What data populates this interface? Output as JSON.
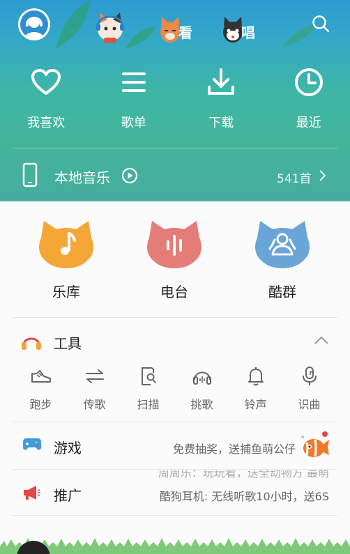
{
  "top_tabs": [
    {
      "name": "listen",
      "label": ""
    },
    {
      "name": "watch",
      "label": "看"
    },
    {
      "name": "sing",
      "label": "唱"
    }
  ],
  "quick_actions": [
    {
      "label": "我喜欢",
      "icon": "heart-icon"
    },
    {
      "label": "歌单",
      "icon": "list-icon"
    },
    {
      "label": "下载",
      "icon": "download-icon"
    },
    {
      "label": "最近",
      "icon": "clock-icon"
    }
  ],
  "local_music": {
    "label": "本地音乐",
    "count": "541首"
  },
  "main_entries": [
    {
      "label": "乐库",
      "icon": "music-note-icon",
      "color": "#f4a637"
    },
    {
      "label": "电台",
      "icon": "radio-wave-icon",
      "color": "#e47c78"
    },
    {
      "label": "酷群",
      "icon": "group-icon",
      "color": "#6aa5d8"
    }
  ],
  "tools": {
    "title": "工具",
    "items": [
      {
        "label": "跑步",
        "icon": "shoe-icon"
      },
      {
        "label": "传歌",
        "icon": "transfer-icon"
      },
      {
        "label": "扫描",
        "icon": "scan-icon"
      },
      {
        "label": "挑歌",
        "icon": "headphones-icon"
      },
      {
        "label": "铃声",
        "icon": "bell-icon"
      },
      {
        "label": "识曲",
        "icon": "mic-icon"
      }
    ]
  },
  "games": {
    "title": "游戏",
    "desc": "免费抽奖，送捕鱼萌公仔"
  },
  "promo": {
    "title": "推广",
    "desc": "酷狗耳机: 无线听歌10小时，送6S",
    "ghost": "周周乐：玩玩看，送全动物方 最萌"
  },
  "colors": {
    "accent_teal": "#3fb5a3",
    "promo_red": "#e5474b",
    "game_blue": "#3d9be0"
  }
}
